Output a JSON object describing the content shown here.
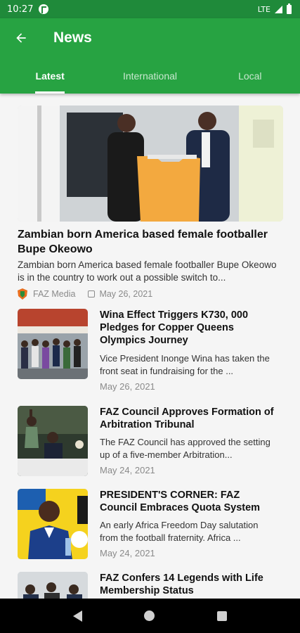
{
  "status_bar": {
    "time": "10:27",
    "network": "LTE"
  },
  "app_bar": {
    "title": "News"
  },
  "tabs": [
    {
      "label": "Latest",
      "active": true
    },
    {
      "label": "International",
      "active": false
    },
    {
      "label": "Local",
      "active": false
    }
  ],
  "featured": {
    "title": "Zambian born America based female footballer Bupe Okeowo",
    "excerpt": "Zambian born America based female footballer Bupe Okeowo is in the country to work out a possible switch to...",
    "source": "FAZ Media",
    "date": "May 26, 2021"
  },
  "articles": [
    {
      "title": "Wina Effect Triggers K730, 000 Pledges for Copper Queens Olympics Journey",
      "excerpt": "Vice President Inonge Wina has taken the front seat in fundraising for the ...",
      "date": "May 26, 2021"
    },
    {
      "title": "FAZ Council Approves Formation of Arbitration Tribunal",
      "excerpt": "The FAZ Council has approved the setting up of a five-member Arbitration...",
      "date": "May 24, 2021"
    },
    {
      "title": "PRESIDENT'S CORNER: FAZ Council Embraces Quota System",
      "excerpt": "An early Africa Freedom Day salutation from the football fraternity. Africa ...",
      "date": "May 24, 2021"
    },
    {
      "title": "FAZ Confers 14 Legends with Life Membership Status",
      "excerpt": "",
      "date": ""
    }
  ],
  "colors": {
    "primary": "#27a342",
    "status_bar": "#1f8a3a"
  }
}
